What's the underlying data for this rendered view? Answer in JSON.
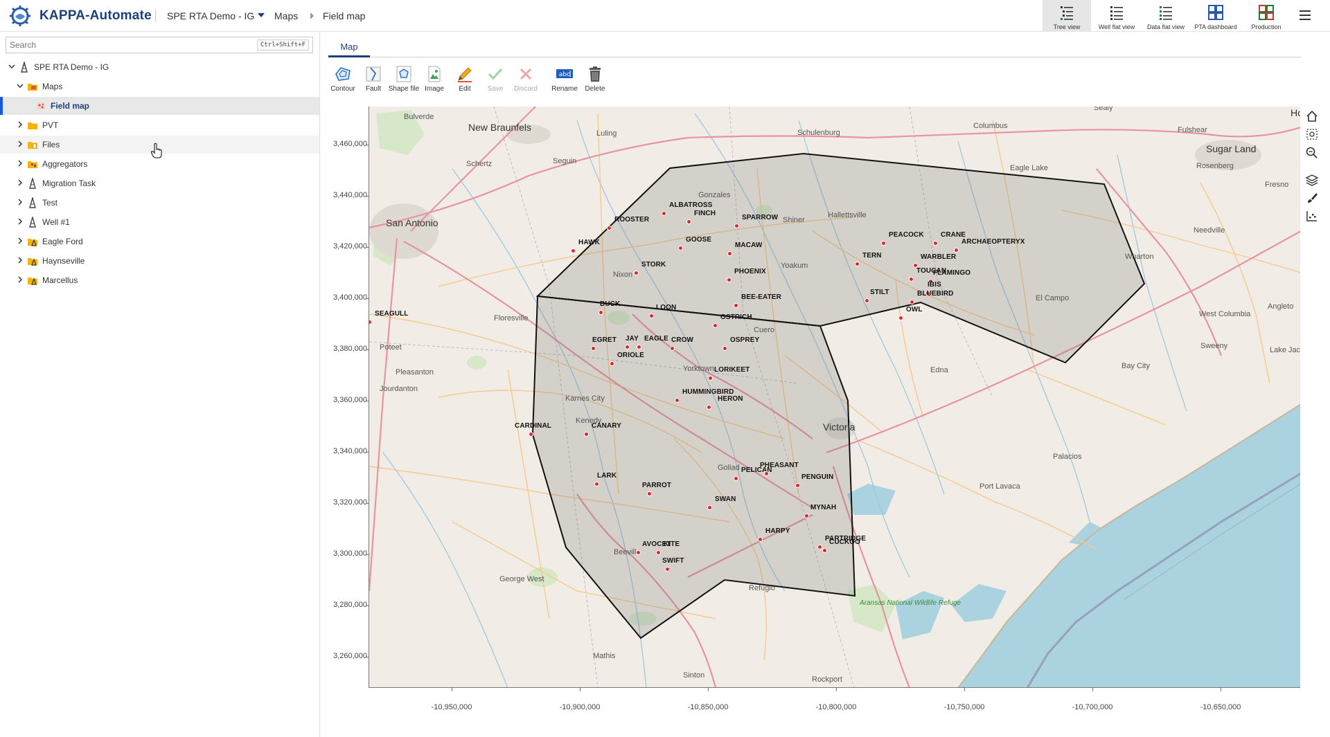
{
  "app": {
    "brand": "KAPPA-Automate",
    "breadcrumb": {
      "project": "SPE RTA Demo - IG",
      "section": "Maps",
      "page": "Field map"
    },
    "views": [
      {
        "label": "Tree view",
        "icon": "tree-view-icon",
        "active": true
      },
      {
        "label": "Well flat view",
        "icon": "well-flat-view-icon",
        "active": false
      },
      {
        "label": "Data flat view",
        "icon": "data-flat-view-icon",
        "active": false
      },
      {
        "label": "PTA dashboard",
        "icon": "pta-dashboard-icon",
        "active": false
      },
      {
        "label": "Production",
        "icon": "production-dashboard-icon",
        "active": false
      }
    ],
    "accent": "#1f3f7a"
  },
  "sidebar": {
    "search": {
      "placeholder": "Search",
      "value": "",
      "shortcut": "Ctrl+Shift+F"
    },
    "tree": [
      {
        "label": "SPE RTA Demo - IG",
        "icon": "field-icon",
        "expanded": true
      },
      {
        "label": "Maps",
        "icon": "maps-folder-icon",
        "expanded": true
      },
      {
        "label": "Field map",
        "icon": "field-map-icon",
        "selected": true
      },
      {
        "label": "PVT",
        "icon": "folder-icon"
      },
      {
        "label": "Files",
        "icon": "folder-icon"
      },
      {
        "label": "Aggregators",
        "icon": "aggregator-folder-icon"
      },
      {
        "label": "Migration Task",
        "icon": "well-icon"
      },
      {
        "label": "Test",
        "icon": "well-icon"
      },
      {
        "label": "Well #1",
        "icon": "well-icon"
      },
      {
        "label": "Eagle Ford",
        "icon": "field-folder-icon"
      },
      {
        "label": "Haynseville",
        "icon": "field-folder-icon"
      },
      {
        "label": "Marcellus",
        "icon": "field-folder-icon"
      }
    ]
  },
  "main": {
    "tab": "Map",
    "toolbar": [
      {
        "label": "Contour",
        "icon": "contour-icon",
        "enabled": true
      },
      {
        "label": "Fault",
        "icon": "fault-icon",
        "enabled": true
      },
      {
        "label": "Shape file",
        "icon": "shape-file-icon",
        "enabled": true
      },
      {
        "label": "Image",
        "icon": "image-icon",
        "enabled": true
      },
      {
        "label": "Edit",
        "icon": "edit-pencil-icon",
        "enabled": true
      },
      {
        "label": "Save",
        "icon": "save-check-icon",
        "enabled": false
      },
      {
        "label": "Discard",
        "icon": "discard-x-icon",
        "enabled": false
      },
      {
        "label": "Rename",
        "icon": "rename-icon",
        "enabled": true
      },
      {
        "label": "Delete",
        "icon": "delete-trash-icon",
        "enabled": true
      }
    ],
    "map": {
      "y_ticks": [
        "3,460,000",
        "3,440,000",
        "3,420,000",
        "3,400,000",
        "3,380,000",
        "3,360,000",
        "3,340,000",
        "3,320,000",
        "3,300,000",
        "3,280,000",
        "3,260,000"
      ],
      "x_ticks": [
        "-10,950,000",
        "-10,900,000",
        "-10,850,000",
        "-10,800,000",
        "-10,750,000",
        "-10,700,000",
        "-10,650,000"
      ],
      "places": {
        "bulverde": "Bulverde",
        "new_braunfels": "New Braunfels",
        "luling": "Luling",
        "schulenburg": "Schulenburg",
        "columbus": "Columbus",
        "sealy": "Sealy",
        "fulshear": "Fulshear",
        "sugar_land": "Sugar Land",
        "ho": "Ho",
        "schertz": "Schertz",
        "seguin": "Seguin",
        "gonzales": "Gonzales",
        "shiner": "Shiner",
        "hallettsville": "Hallettsville",
        "eagle_lake": "Eagle Lake",
        "rosenberg": "Rosenberg",
        "fresno": "Fresno",
        "san_antonio": "San Antonio",
        "needville": "Needville",
        "nixon": "Nixon",
        "yoakum": "Yoakum",
        "wharton": "Wharton",
        "el_campo": "El Campo",
        "floresville": "Floresville",
        "angleton": "Angleto",
        "west_columbia": "West Columbia",
        "poteet": "Poteet",
        "cuero": "Cuero",
        "sweeny": "Sweeny",
        "lake_jackson": "Lake Jacks",
        "pleasanton": "Pleasanton",
        "yorktown": "Yorktown",
        "edna": "Edna",
        "bay_city": "Bay City",
        "jourdanton": "Jourdanton",
        "karnes_city": "Karnes City",
        "kenedy": "Kenedy",
        "victoria": "Victoria",
        "goliad": "Goliad",
        "palacios": "Palacios",
        "port_lavaca": "Port Lavaca",
        "george_west": "George West",
        "beeville": "Beeville",
        "refugio": "Refugio",
        "aransas": "Aransas National Wildlife Refuge",
        "mathis": "Mathis",
        "sinton": "Sinton",
        "rockport": "Rockport"
      },
      "wells": [
        {
          "name": "ALBATROSS"
        },
        {
          "name": "FINCH"
        },
        {
          "name": "ROOSTER"
        },
        {
          "name": "SPARROW"
        },
        {
          "name": "GOOSE"
        },
        {
          "name": "MACAW"
        },
        {
          "name": "HAWK"
        },
        {
          "name": "STORK"
        },
        {
          "name": "PHOENIX"
        },
        {
          "name": "BEE-EATER"
        },
        {
          "name": "PEACOCK"
        },
        {
          "name": "CRANE"
        },
        {
          "name": "ARCHAEOPTERYX"
        },
        {
          "name": "TERN"
        },
        {
          "name": "WARBLER"
        },
        {
          "name": "TOUCAN"
        },
        {
          "name": "FLAMINGO"
        },
        {
          "name": "IBIS"
        },
        {
          "name": "STILT"
        },
        {
          "name": "BLUEBIRD"
        },
        {
          "name": "OWL"
        },
        {
          "name": "SEAGULL"
        },
        {
          "name": "DUCK"
        },
        {
          "name": "LOON"
        },
        {
          "name": "OSTRICH"
        },
        {
          "name": "EGRET"
        },
        {
          "name": "JAY"
        },
        {
          "name": "EAGLE"
        },
        {
          "name": "CROW"
        },
        {
          "name": "OSPREY"
        },
        {
          "name": "ORIOLE"
        },
        {
          "name": "LORIKEET"
        },
        {
          "name": "HUMMINGBIRD"
        },
        {
          "name": "HERON"
        },
        {
          "name": "CARDINAL"
        },
        {
          "name": "CANARY"
        },
        {
          "name": "LARK"
        },
        {
          "name": "PARROT"
        },
        {
          "name": "PELICAN"
        },
        {
          "name": "PHEASANT"
        },
        {
          "name": "PENGUIN"
        },
        {
          "name": "MYNAH"
        },
        {
          "name": "SWAN"
        },
        {
          "name": "HARPY"
        },
        {
          "name": "PARTRIDGE"
        },
        {
          "name": "CUCKOO"
        },
        {
          "name": "AVOCET"
        },
        {
          "name": "KITE"
        },
        {
          "name": "SWIFT"
        }
      ],
      "colors": {
        "land": "#f1ede6",
        "water": "#aad3df",
        "well": "#e0262c",
        "polygon_fill": "rgba(110,110,110,0.22)",
        "road_major": "#e892a2",
        "road_minor": "#f7c98b"
      }
    }
  }
}
